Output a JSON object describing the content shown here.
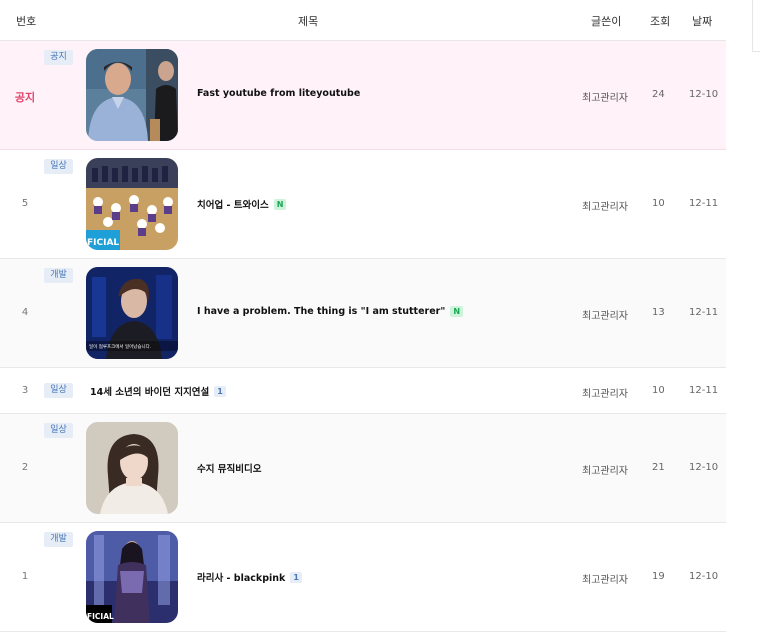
{
  "header": {
    "num": "번호",
    "title": "제목",
    "author": "글쓴이",
    "views": "조회",
    "date": "날짜"
  },
  "rows": [
    {
      "num": "공지",
      "category": "공지",
      "title": "Fast youtube from liteyoutube",
      "badge": "",
      "author": "최고관리자",
      "views": "24",
      "date": "12-10",
      "thumb_caption": ""
    },
    {
      "num": "5",
      "category": "일상",
      "title": "치어업 - 트와이스",
      "badge": "N",
      "author": "최고관리자",
      "views": "10",
      "date": "12-11",
      "thumb_caption": "FICIAL"
    },
    {
      "num": "4",
      "category": "개발",
      "title": "I have a problem. The thing is \"I am stutterer\"",
      "badge": "N",
      "author": "최고관리자",
      "views": "13",
      "date": "12-11",
      "thumb_caption": "일이 협루프크에서 일어났습니다."
    },
    {
      "num": "3",
      "category": "일상",
      "title": "14세 소년의 바이던 지지연설",
      "badge": "1",
      "author": "최고관리자",
      "views": "10",
      "date": "12-11",
      "thumb_caption": ""
    },
    {
      "num": "2",
      "category": "일상",
      "title": "수지 뮤직비디오",
      "badge": "",
      "author": "최고관리자",
      "views": "21",
      "date": "12-10",
      "thumb_caption": ""
    },
    {
      "num": "1",
      "category": "개발",
      "title": "라리사 - blackpink",
      "badge": "1",
      "author": "최고관리자",
      "views": "19",
      "date": "12-10",
      "thumb_caption": "FICIAL"
    }
  ],
  "colors": {
    "notice_bg": "#fff2f8",
    "notice_text": "#e2456b",
    "category_bg": "#e6edf7",
    "category_text": "#4a78b5",
    "new_badge_bg": "#cdf3db",
    "new_badge_text": "#1aa553"
  }
}
